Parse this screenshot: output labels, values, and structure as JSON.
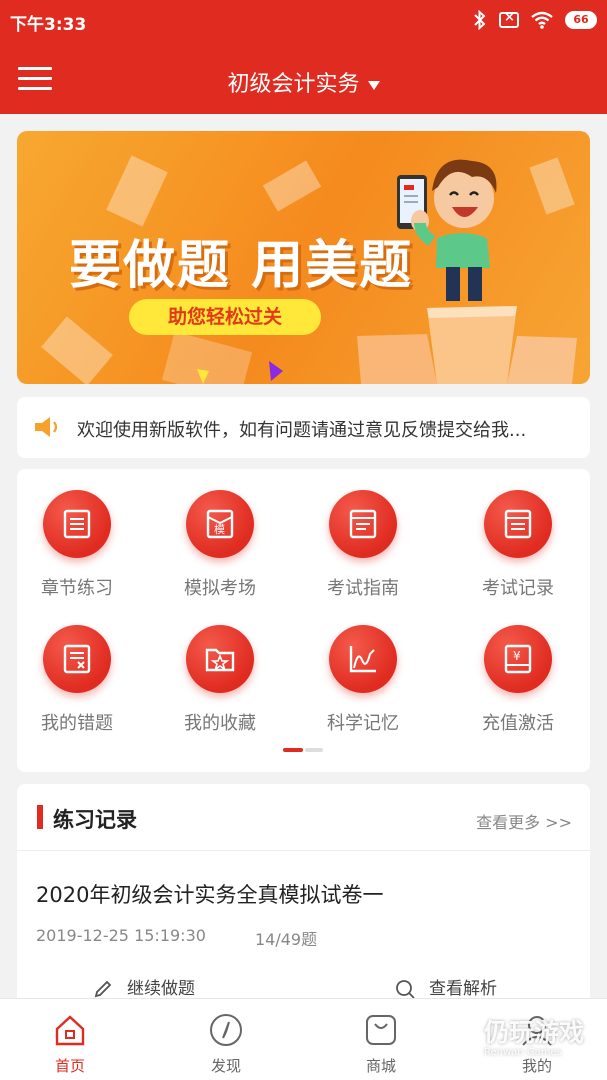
{
  "status_bar": {
    "time": "下午3:33",
    "battery": "66",
    "icons": [
      "bluetooth-icon",
      "no-sim-icon",
      "wifi-icon",
      "battery-icon"
    ]
  },
  "nav": {
    "title": "初级会计实务",
    "menu_icon": "hamburger-menu-icon",
    "dropdown_icon": "caret-down-icon"
  },
  "banner": {
    "headline": "要做题 用美题",
    "tagline": "助您轻松过关"
  },
  "notice": {
    "icon": "speaker-icon",
    "text": "欢迎使用新版软件，如有问题请通过意见反馈提交给我..."
  },
  "menu": {
    "items": [
      {
        "label": "章节练习",
        "icon": "document-icon"
      },
      {
        "label": "模拟考场",
        "icon": "mock-exam-icon"
      },
      {
        "label": "考试指南",
        "icon": "guide-book-icon"
      },
      {
        "label": "考试记录",
        "icon": "record-book-icon"
      },
      {
        "label": "我的错题",
        "icon": "wrong-question-icon"
      },
      {
        "label": "我的收藏",
        "icon": "favorite-folder-icon"
      },
      {
        "label": "科学记忆",
        "icon": "memory-curve-icon"
      },
      {
        "label": "充值激活",
        "icon": "recharge-icon"
      }
    ],
    "page_indicator": {
      "current": 1,
      "total": 2
    }
  },
  "records": {
    "title": "练习记录",
    "more": "查看更多 >>",
    "exam_name": "2020年初级会计实务全真模拟试卷一",
    "datetime": "2019-12-25 15:19:30",
    "progress": "14/49题",
    "continue_label": "继续做题",
    "review_label": "查看解析"
  },
  "tabbar": {
    "items": [
      {
        "label": "首页",
        "icon": "home-icon",
        "active": true
      },
      {
        "label": "发现",
        "icon": "compass-icon",
        "active": false
      },
      {
        "label": "商城",
        "icon": "shop-bag-icon",
        "active": false
      },
      {
        "label": "我的",
        "icon": "user-icon",
        "active": false
      }
    ]
  },
  "watermark": {
    "text": "仍玩游戏",
    "sub": "Renwan Games"
  },
  "colors": {
    "primary": "#e02b20",
    "banner_orange": "#f58a1e",
    "pill_yellow": "#ffe83a"
  }
}
